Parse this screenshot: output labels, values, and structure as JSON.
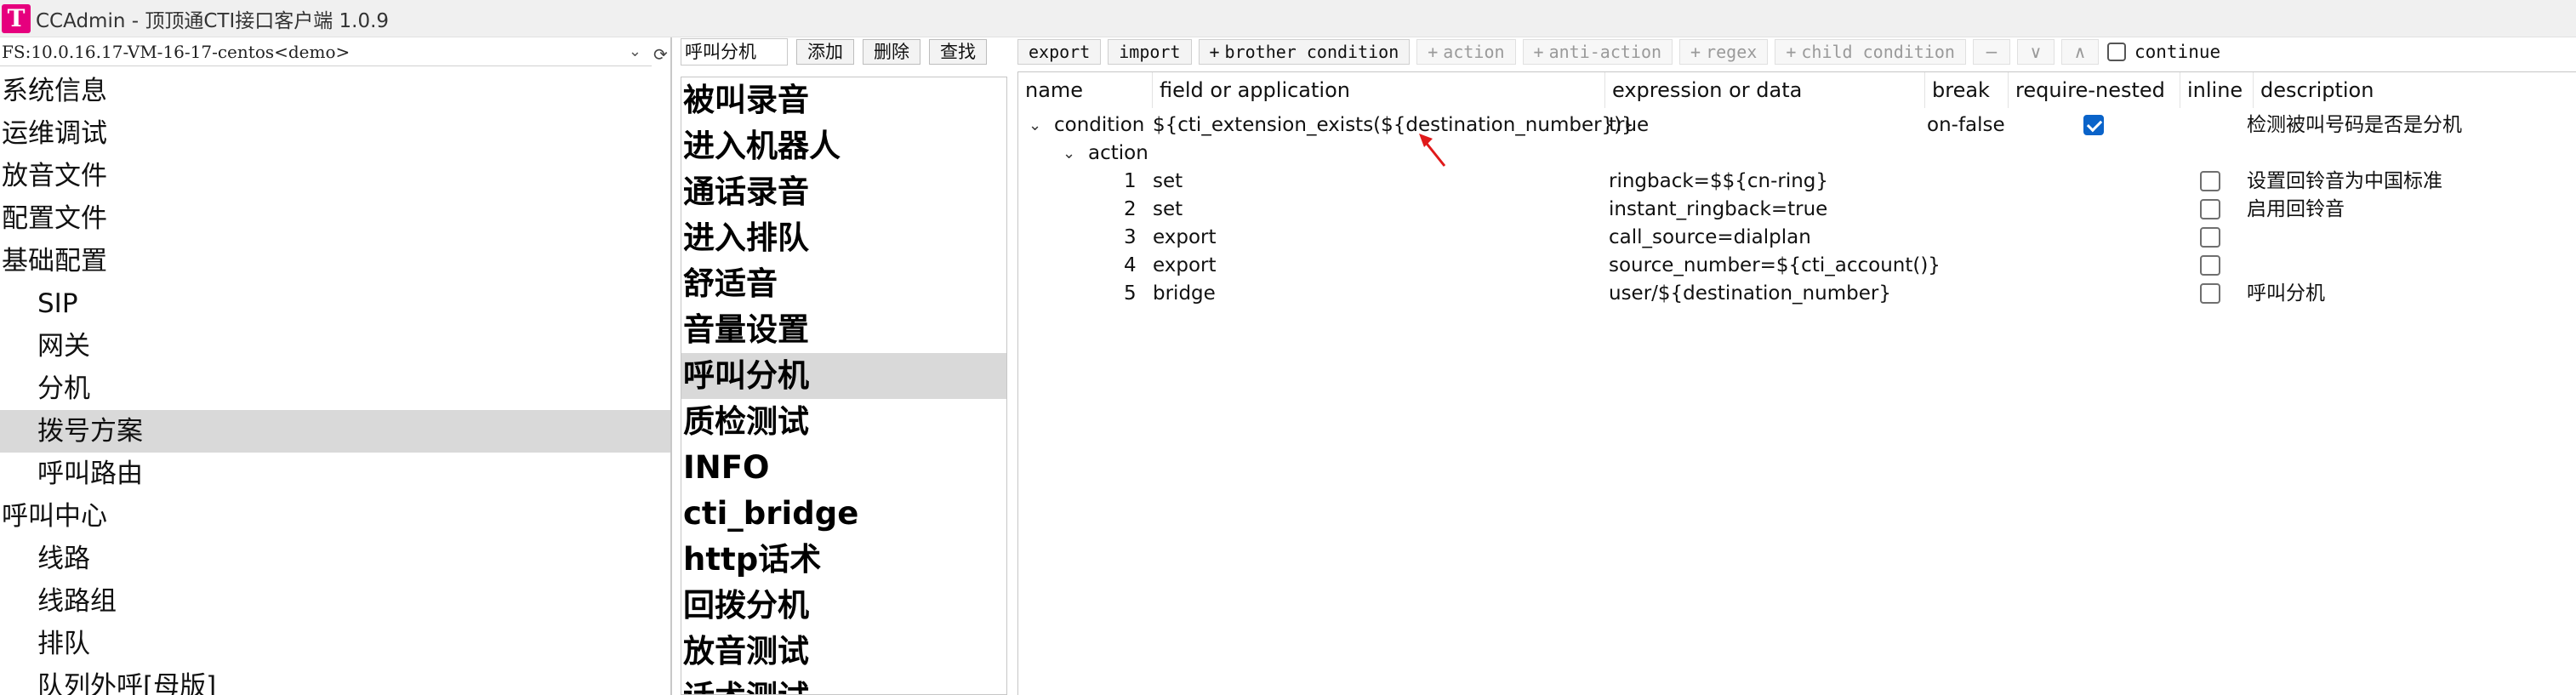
{
  "window": {
    "title": "CCAdmin - 顶顶通CTI接口客户端 1.0.9",
    "logo_letter": "T"
  },
  "left": {
    "server": "FS:10.0.16.17-VM-16-17-centos<demo>",
    "tree": [
      {
        "label": "系统信息",
        "child": false,
        "selected": false
      },
      {
        "label": "运维调试",
        "child": false,
        "selected": false
      },
      {
        "label": "放音文件",
        "child": false,
        "selected": false
      },
      {
        "label": "配置文件",
        "child": false,
        "selected": false
      },
      {
        "label": "基础配置",
        "child": false,
        "selected": false
      },
      {
        "label": "SIP",
        "child": true,
        "selected": false
      },
      {
        "label": "网关",
        "child": true,
        "selected": false
      },
      {
        "label": "分机",
        "child": true,
        "selected": false
      },
      {
        "label": "拨号方案",
        "child": true,
        "selected": true
      },
      {
        "label": "呼叫路由",
        "child": true,
        "selected": false
      },
      {
        "label": "呼叫中心",
        "child": false,
        "selected": false
      },
      {
        "label": "线路",
        "child": true,
        "selected": false
      },
      {
        "label": "线路组",
        "child": true,
        "selected": false
      },
      {
        "label": "排队",
        "child": true,
        "selected": false
      },
      {
        "label": "队列外呼[母版]",
        "child": true,
        "selected": false
      }
    ]
  },
  "middle": {
    "input_value": "呼叫分机",
    "buttons": {
      "add": "添加",
      "delete": "删除",
      "find": "查找"
    },
    "items": [
      {
        "label": "被叫录音",
        "selected": false
      },
      {
        "label": "进入机器人",
        "selected": false
      },
      {
        "label": "通话录音",
        "selected": false
      },
      {
        "label": "进入排队",
        "selected": false
      },
      {
        "label": "舒适音",
        "selected": false
      },
      {
        "label": "音量设置",
        "selected": false
      },
      {
        "label": "呼叫分机",
        "selected": true
      },
      {
        "label": "质检测试",
        "selected": false
      },
      {
        "label": "INFO",
        "selected": false
      },
      {
        "label": "cti_bridge",
        "selected": false
      },
      {
        "label": "http话术",
        "selected": false
      },
      {
        "label": "回拨分机",
        "selected": false
      },
      {
        "label": "放音测试",
        "selected": false
      },
      {
        "label": "话术测试",
        "selected": false
      }
    ]
  },
  "toolbar": {
    "export": "export",
    "import": "import",
    "brother": "brother condition",
    "action": "action",
    "anti_action": "anti-action",
    "regex": "regex",
    "child": "child condition",
    "minus_icon": "minus-icon",
    "down_icon": "chevron-down-icon",
    "up_icon": "chevron-up-icon",
    "continue_label": "continue",
    "continue_checked": false
  },
  "grid": {
    "headers": {
      "name": "name",
      "field": "field or application",
      "expression": "expression or data",
      "break": "break",
      "require_nested": "require-nested",
      "inline": "inline",
      "description": "description"
    },
    "condition": {
      "name": "condition",
      "field": "${cti_extension_exists(${destination_number})}",
      "expression": "true",
      "break": "on-false",
      "require_nested": true,
      "description": "检测被叫号码是否是分机"
    },
    "action_group": {
      "label": "action"
    },
    "actions": [
      {
        "index": "1",
        "app": "set",
        "data": "ringback=$${cn-ring}",
        "inline": false,
        "description": "设置回铃音为中国标准"
      },
      {
        "index": "2",
        "app": "set",
        "data": "instant_ringback=true",
        "inline": false,
        "description": "启用回铃音"
      },
      {
        "index": "3",
        "app": "export",
        "data": "call_source=dialplan",
        "inline": false,
        "description": ""
      },
      {
        "index": "4",
        "app": "export",
        "data": "source_number=${cti_account()}",
        "inline": false,
        "description": ""
      },
      {
        "index": "5",
        "app": "bridge",
        "data": "user/${destination_number}",
        "inline": false,
        "description": "呼叫分机"
      }
    ]
  },
  "colors": {
    "accent": "#0a63c9",
    "logo": "#e6007e",
    "selection": "#d9d9d9",
    "arrow": "#e0191a"
  }
}
